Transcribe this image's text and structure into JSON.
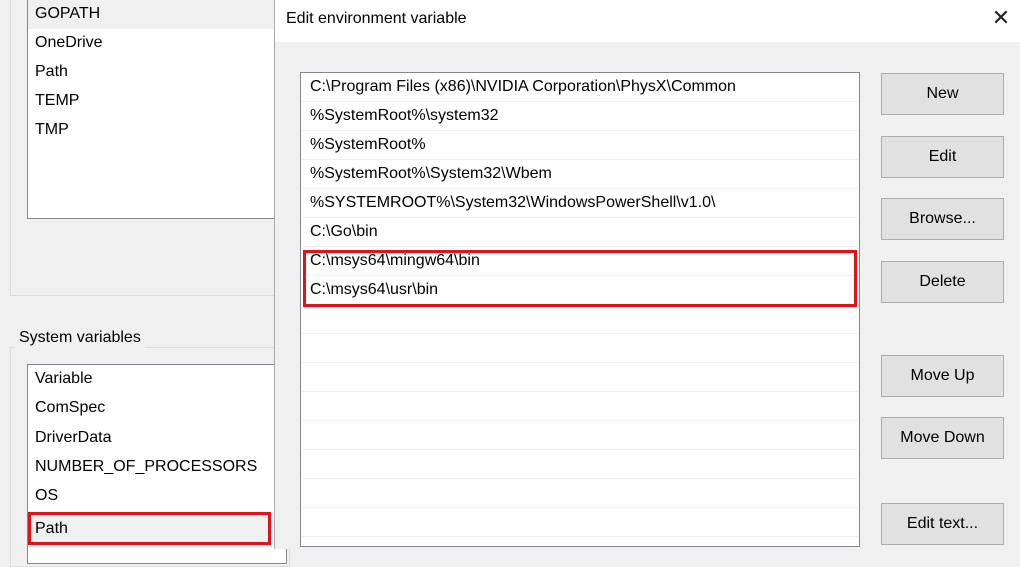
{
  "background": {
    "user_variables": [
      "GOPATH",
      "OneDrive",
      "Path",
      "TEMP",
      "TMP"
    ],
    "system_variables_label": "System variables",
    "system_variables_header": "Variable",
    "system_variables": [
      "ComSpec",
      "DriverData",
      "NUMBER_OF_PROCESSORS",
      "OS"
    ],
    "selected_system_variable": "Path"
  },
  "dialog": {
    "title": "Edit environment variable",
    "close_glyph": "✕",
    "entries": [
      "C:\\Program Files (x86)\\NVIDIA Corporation\\PhysX\\Common",
      "%SystemRoot%\\system32",
      "%SystemRoot%",
      "%SystemRoot%\\System32\\Wbem",
      "%SYSTEMROOT%\\System32\\WindowsPowerShell\\v1.0\\",
      "C:\\Go\\bin",
      "C:\\msys64\\mingw64\\bin",
      "C:\\msys64\\usr\\bin"
    ],
    "buttons": {
      "new": "New",
      "edit": "Edit",
      "browse": "Browse...",
      "delete": "Delete",
      "move_up": "Move Up",
      "move_down": "Move Down",
      "edit_text": "Edit text..."
    },
    "highlight_color": "#e0121b"
  }
}
